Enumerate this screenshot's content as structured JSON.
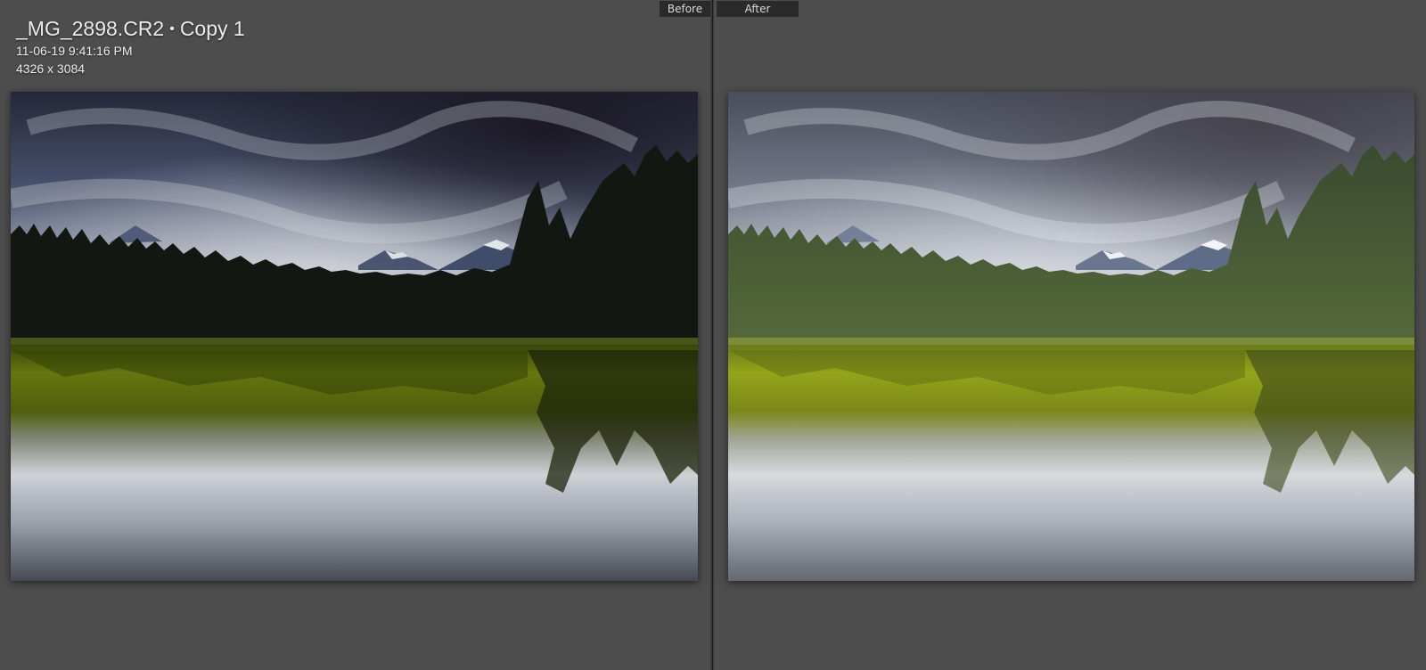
{
  "header": {
    "filename": "_MG_2898.CR2",
    "separator": "•",
    "copy_label": "Copy 1",
    "datetime": "11-06-19 9:41:16 PM",
    "dimensions": "4326 x 3084"
  },
  "views": {
    "before_label": "Before",
    "after_label": "After"
  }
}
